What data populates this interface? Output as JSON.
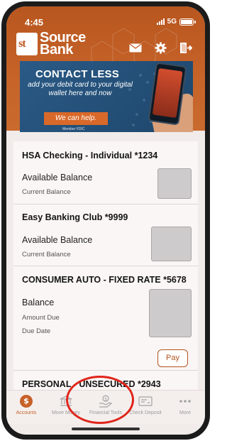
{
  "status_bar": {
    "time": "4:45",
    "network": "5G"
  },
  "brand": {
    "mark": "st",
    "name_line1": "Source",
    "name_line2": "Bank"
  },
  "header_icons": [
    "mail-icon",
    "gear-icon",
    "logout-icon"
  ],
  "banner": {
    "title": "CONTACT LESS",
    "subtitle": "add your debit card to your digital wallet here and now",
    "button": "We can help.",
    "footnote": "Member FDIC"
  },
  "accounts": [
    {
      "name": "HSA Checking - Individual *1234",
      "label1": "Available Balance",
      "label2": "Current Balance"
    },
    {
      "name": "Easy Banking Club *9999",
      "label1": "Available Balance",
      "label2": "Current Balance"
    },
    {
      "name": "CONSUMER AUTO - FIXED RATE *5678",
      "label1": "Balance",
      "label2": "Amount Due",
      "label3": "Due Date",
      "action": "Pay"
    },
    {
      "name": "PERSONAL - UNSECURED *2943"
    }
  ],
  "tabs": [
    {
      "label": "Accounts",
      "icon": "dollar-circle-icon",
      "active": true
    },
    {
      "label": "Move Money",
      "icon": "bank-icon",
      "active": false
    },
    {
      "label": "Financial Tools",
      "icon": "hand-coin-icon",
      "active": false
    },
    {
      "label": "Check Deposit",
      "icon": "check-icon",
      "active": false
    },
    {
      "label": "More",
      "icon": "more-dots-icon",
      "active": false
    }
  ],
  "colors": {
    "brand_orange": "#c7612a",
    "banner_blue": "#1e466b",
    "highlight_red": "#e0251b"
  }
}
